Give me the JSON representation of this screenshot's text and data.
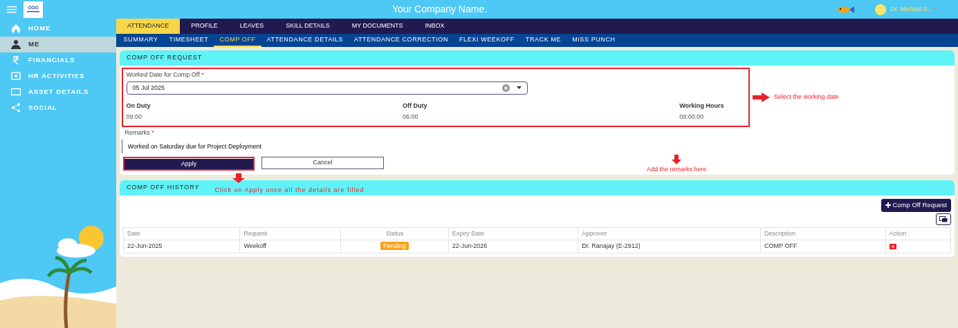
{
  "header": {
    "title": "Your Company Name.",
    "user": "Dr. Michael E.."
  },
  "sidebar": {
    "items": [
      {
        "label": "HOME",
        "kind": "home",
        "selected": false
      },
      {
        "label": "ME",
        "kind": "person",
        "selected": true
      },
      {
        "label": "FINANCIALS",
        "kind": "rupee",
        "selected": false
      },
      {
        "label": "HR ACTIVITIES",
        "kind": "badge",
        "selected": false
      },
      {
        "label": "ASSET DETAILS",
        "kind": "screen",
        "selected": false
      },
      {
        "label": "SOCIAL",
        "kind": "share",
        "selected": false
      }
    ]
  },
  "tabs": [
    {
      "label": "ATTENDANCE",
      "selected": true
    },
    {
      "label": "PROFILE",
      "selected": false
    },
    {
      "label": "LEAVES",
      "selected": false
    },
    {
      "label": "SKILL DETAILS",
      "selected": false
    },
    {
      "label": "MY DOCUMENTS",
      "selected": false
    },
    {
      "label": "INBOX",
      "selected": false
    }
  ],
  "subtabs": [
    {
      "label": "SUMMARY",
      "selected": false
    },
    {
      "label": "TIMESHEET",
      "selected": false
    },
    {
      "label": "COMP OFF",
      "selected": true
    },
    {
      "label": "ATTENDANCE DETAILS",
      "selected": false
    },
    {
      "label": "ATTENDANCE CORRECTION",
      "selected": false
    },
    {
      "label": "FLEXI WEEKOFF",
      "selected": false
    },
    {
      "label": "TRACK ME",
      "selected": false
    },
    {
      "label": "MISS PUNCH",
      "selected": false
    }
  ],
  "request_card": {
    "title": "COMP OFF REQUEST",
    "date_label": "Worked Date for Comp Off",
    "date_required": "*",
    "date_value": "05 Jul 2025",
    "durations": [
      {
        "label": "On Duty",
        "value": "09:00"
      },
      {
        "label": "Off Duty",
        "value": "06:00"
      },
      {
        "label": "Working Hours",
        "value": "09:00:00"
      }
    ],
    "remarks_label": "Remarks",
    "remarks_required": "*",
    "remarks_value": "Worked on Saturday due for Project Deployment",
    "apply": "Apply",
    "cancel": "Cancel"
  },
  "history_card": {
    "title": "COMP OFF HISTORY",
    "new_button": "Comp Off Request",
    "columns": [
      "Date",
      "Request",
      "Status",
      "Expiry Date",
      "Approver",
      "Description",
      "Action"
    ],
    "rows": [
      {
        "date": "22-Jun-2025",
        "request": "Weekoff",
        "status": "Pending",
        "expiry": "22-Jun-2026",
        "approver": "Dr. Ranajay (E-2912)",
        "description": "COMP OFF"
      }
    ]
  },
  "annotations": {
    "date": "Select the working date",
    "remarks": "Add the remarks here",
    "apply": "Click on Apply once all the details are filled"
  }
}
